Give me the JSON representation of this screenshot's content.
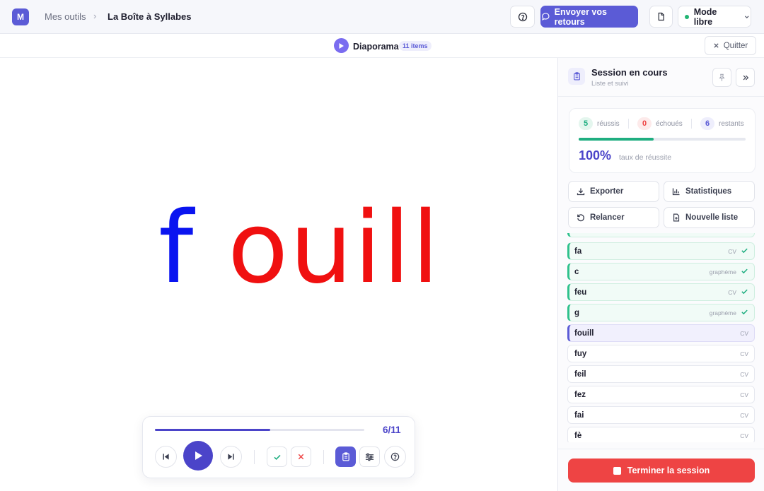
{
  "header": {
    "logo_letter": "M",
    "breadcrumb": [
      "Mes outils",
      "La Boîte à Syllabes"
    ],
    "breadcrumb_sep": "›",
    "feedback_label": "Envoyer vos retours",
    "mode_label": "Mode libre"
  },
  "subbar": {
    "title": "Diaporama",
    "badge": "11 items",
    "quit_label": "Quitter"
  },
  "display": {
    "first_letter": "f",
    "rest": " ouill",
    "colors": {
      "first": "#0a14f0",
      "rest": "#f01010"
    }
  },
  "player": {
    "progress": 0.55,
    "counter": "6/11"
  },
  "panel": {
    "title": "Session en cours",
    "subtitle": "Liste et suivi",
    "stats": {
      "success_count": "5",
      "success_label": "réussis",
      "failed_count": "0",
      "failed_label": "échoués",
      "remaining_count": "6",
      "remaining_label": "restants",
      "progress": 0.45,
      "rate": "100%",
      "rate_label": "taux de réussite"
    },
    "actions": {
      "export": "Exporter",
      "stats": "Statistiques",
      "restart": "Relancer",
      "new_list": "Nouvelle liste"
    },
    "items": [
      {
        "text": "fa",
        "type": "CV",
        "state": "ok"
      },
      {
        "text": "c",
        "type": "graphème",
        "state": "ok"
      },
      {
        "text": "feu",
        "type": "CV",
        "state": "ok"
      },
      {
        "text": "g",
        "type": "graphème",
        "state": "ok"
      },
      {
        "text": "fouill",
        "type": "CV",
        "state": "current"
      },
      {
        "text": "fuy",
        "type": "CV",
        "state": "pending"
      },
      {
        "text": "feil",
        "type": "CV",
        "state": "pending"
      },
      {
        "text": "fez",
        "type": "CV",
        "state": "pending"
      },
      {
        "text": "fai",
        "type": "CV",
        "state": "pending"
      },
      {
        "text": "fè",
        "type": "CV",
        "state": "pending"
      }
    ],
    "end_label": "Terminer la session"
  },
  "colors": {
    "accent": "#5b5bd6",
    "success": "#1fae80",
    "danger": "#ee4444"
  }
}
